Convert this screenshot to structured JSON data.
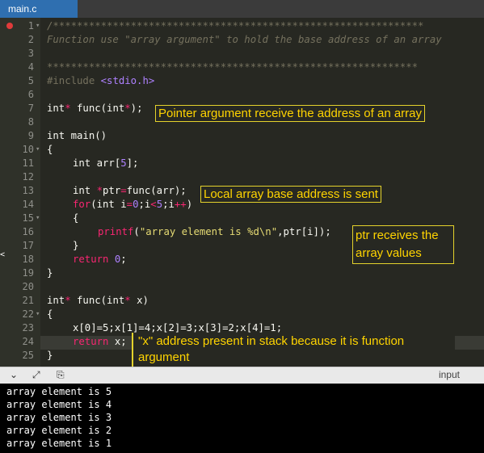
{
  "tab": {
    "filename": "main.c"
  },
  "line_numbers": [
    "1",
    "2",
    "3",
    "4",
    "5",
    "6",
    "7",
    "8",
    "9",
    "10",
    "11",
    "12",
    "13",
    "14",
    "15",
    "16",
    "17",
    "18",
    "19",
    "20",
    "21",
    "22",
    "23",
    "24",
    "25"
  ],
  "code_text": {
    "l1": "/**************************************************************",
    "l2": "Function use \"array argument\" to hold the base address of an array",
    "l4": "**************************************************************",
    "l5_a": "#include ",
    "l5_b": "<stdio.h>",
    "l7_a": "int",
    "l7_b": "*",
    "l7_c": " func(",
    "l7_d": "int",
    "l7_e": "*",
    "l7_f": ");",
    "l9_a": "int",
    "l9_b": " main()",
    "brace_open": "{",
    "brace_close": "}",
    "l11_a": "int",
    "l11_b": " arr[",
    "l11_c": "5",
    "l11_d": "];",
    "l13_a": "int",
    "l13_b": " ",
    "l13_c": "*",
    "l13_d": "ptr",
    "l13_e": "=",
    "l13_f": "func(arr);",
    "l14_a": "for",
    "l14_b": "(",
    "l14_c": "int",
    "l14_d": " i",
    "l14_e": "=",
    "l14_f": "0",
    "l14_g": ";i",
    "l14_h": "<",
    "l14_i": "5",
    "l14_j": ";i",
    "l14_k": "++",
    "l14_l": ")",
    "l16_a": "printf",
    "l16_b": "(",
    "l16_c": "\"array element is %d\\n\"",
    "l16_d": ",ptr[i]);",
    "l18_a": "return",
    "l18_b": " ",
    "l18_c": "0",
    "l18_d": ";",
    "l21_a": "int",
    "l21_b": "*",
    "l21_c": " func(",
    "l21_d": "int",
    "l21_e": "*",
    "l21_f": " x)",
    "l23": "x[0]=5;x[1]=4;x[2]=3;x[3]=2;x[4]=1;",
    "l24_a": "return",
    "l24_b": " x;"
  },
  "annotations": {
    "a1": "Pointer argument receive the address of an array",
    "a2": "Local array base address is sent",
    "a3": "ptr receives the array values",
    "a4": "\"x\" address present in stack because it is function argument"
  },
  "panel": {
    "input_label": "input"
  },
  "output_lines": [
    "array element is 5",
    "array element is 4",
    "array element is 3",
    "array element is 2",
    "array element is 1"
  ],
  "colors": {
    "accent": "#2f6fb0",
    "annotation": "#ffd400",
    "breakpoint": "#e03b3b"
  }
}
